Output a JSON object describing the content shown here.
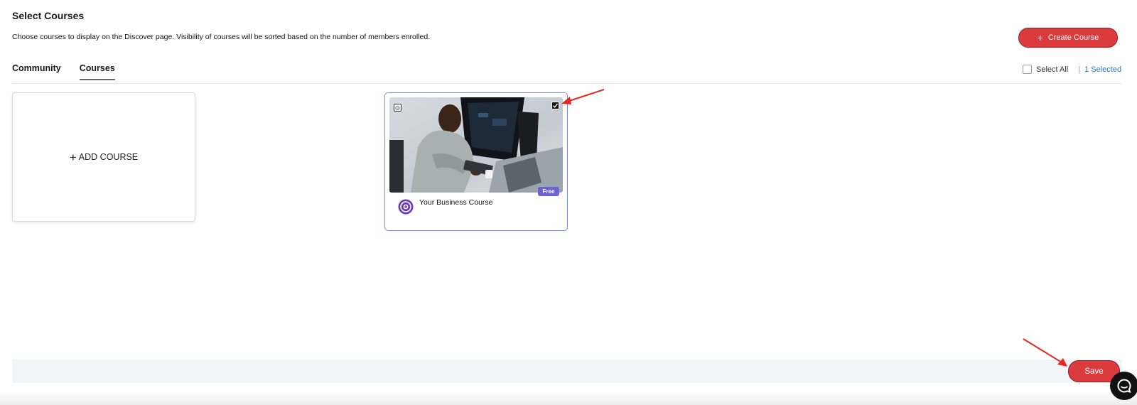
{
  "header": {
    "title": "Select Courses",
    "description": "Choose courses to display on the Discover page. Visibility of courses will be sorted based on the number of members enrolled.",
    "create_button": {
      "label": "Create Course",
      "icon": "plus-icon"
    }
  },
  "tabs": [
    {
      "label": "Community",
      "active": false
    },
    {
      "label": "Courses",
      "active": true
    }
  ],
  "selection": {
    "select_all_label": "Select All",
    "separator": "|",
    "selected_count": "1 Selected"
  },
  "add_card": {
    "label": "ADD COURSE",
    "icon": "plus-icon"
  },
  "courses": [
    {
      "name": "Your Business Course",
      "badge": "Free",
      "selected": true,
      "logo_icon": "course-logo-icon",
      "image_icon": "image-icon"
    }
  ],
  "footer": {
    "save_label": "Save"
  },
  "chat": {
    "icon": "chat-icon"
  },
  "colors": {
    "primary_red": "#dc3b3e",
    "red_border": "#8f1f22",
    "link_blue": "#2f6fd6",
    "selected_border": "#7b8fe0",
    "badge_purple": "#6c63d8",
    "footer_bg": "#f2f5f8",
    "annotation_arrow": "#e8261e"
  }
}
